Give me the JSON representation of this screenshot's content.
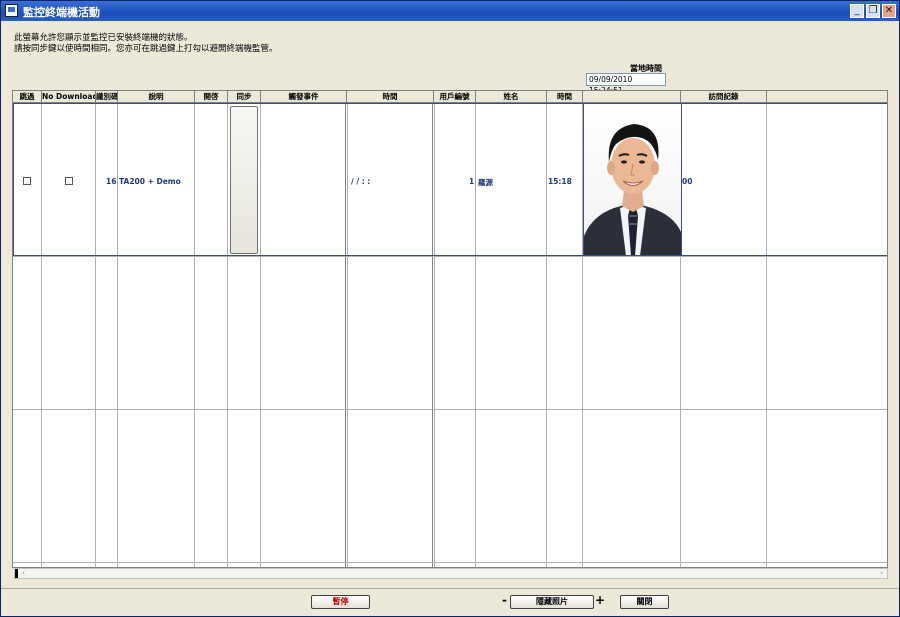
{
  "window": {
    "title": "監控終端機活動",
    "controls": {
      "minimize": "_",
      "restore": "❐",
      "close": "✕"
    }
  },
  "info": {
    "line1": "此螢幕允許您顯示並監控已安裝終端機的狀態。",
    "line2": "請按同步鍵以使時間相同。您亦可在跳過鍵上打勾以避開終端機監管。"
  },
  "clock": {
    "label": "當地時間",
    "value": "09/09/2010 15:24:51"
  },
  "table": {
    "columns": [
      "跳過",
      "No Download",
      "識別碼",
      "說明",
      "開啓",
      "同步",
      "觸發事件",
      "時間",
      "用戶編號",
      "姓名",
      "時間",
      "",
      "訪問記錄"
    ],
    "row": {
      "skip_checked": false,
      "no_download_checked": false,
      "id": "16",
      "description": "TA200 + Demo",
      "trigger_time": "/ /     : :",
      "user_no": "1",
      "name": "羅源",
      "time": "15:18",
      "access_log": "00"
    }
  },
  "footer": {
    "pause_label": "暫停",
    "minus": "-",
    "hide_photo_label": "隱藏照片",
    "plus": "+",
    "close_label": "關閉"
  },
  "colors": {
    "accent": "#1f3a7a",
    "pause_text": "#c00000",
    "titlebar": "#2a5fc8"
  }
}
